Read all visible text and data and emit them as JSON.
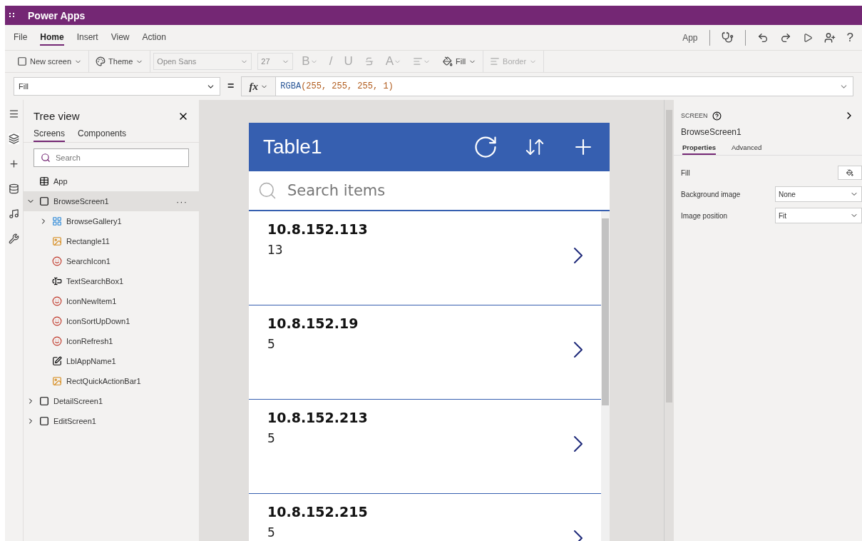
{
  "app_bar": {
    "title": "Power Apps"
  },
  "menu": [
    {
      "label": "File",
      "selected": false
    },
    {
      "label": "Home",
      "selected": true
    },
    {
      "label": "Insert",
      "selected": false
    },
    {
      "label": "View",
      "selected": false
    },
    {
      "label": "Action",
      "selected": false
    }
  ],
  "app_label": "App",
  "help_label": "?",
  "toolbar": [
    {
      "kind": "newscreen",
      "label": "New screen",
      "disabled": false
    },
    {
      "kind": "theme",
      "label": "Theme",
      "disabled": false
    },
    {
      "kind": "font",
      "label": "Open Sans",
      "disabled": true
    },
    {
      "kind": "size",
      "label": "27",
      "disabled": true
    },
    {
      "kind": "bold",
      "label": "B",
      "disabled": true
    },
    {
      "kind": "italic",
      "label": "/",
      "disabled": true
    },
    {
      "kind": "underline",
      "label": "U",
      "disabled": true
    },
    {
      "kind": "strike",
      "disabled": true
    },
    {
      "kind": "color",
      "label": "A",
      "disabled": true
    },
    {
      "kind": "align",
      "disabled": true
    },
    {
      "kind": "fill",
      "label": "Fill",
      "disabled": false
    },
    {
      "kind": "border",
      "label": "Border",
      "disabled": true
    }
  ],
  "formula": {
    "property": "Fill",
    "equals": "=",
    "fx": "fx",
    "func": "RGBA",
    "args": "(255, 255, 255, 1)"
  },
  "tree": {
    "title": "Tree view",
    "tabs": [
      {
        "label": "Screens",
        "selected": true
      },
      {
        "label": "Components",
        "selected": false
      }
    ],
    "search": {
      "placeholder": "Search"
    },
    "items": [
      {
        "kind": "app",
        "label": "App",
        "selected": false
      },
      {
        "kind": "screen",
        "label": "BrowseScreen1",
        "expanded": true,
        "selected": true,
        "more": "···",
        "children": [
          {
            "kind": "gallery",
            "label": "BrowseGallery1",
            "expanded": false
          },
          {
            "kind": "rectangle",
            "label": "Rectangle11"
          },
          {
            "kind": "icon",
            "label": "SearchIcon1"
          },
          {
            "kind": "textbox",
            "label": "TextSearchBox1"
          },
          {
            "kind": "icon",
            "label": "IconNewItem1"
          },
          {
            "kind": "icon",
            "label": "IconSortUpDown1"
          },
          {
            "kind": "icon",
            "label": "IconRefresh1"
          },
          {
            "kind": "label",
            "label": "LblAppName1"
          },
          {
            "kind": "rectangle",
            "label": "RectQuickActionBar1"
          }
        ]
      },
      {
        "kind": "screen",
        "label": "DetailScreen1",
        "expanded": false,
        "selected": false
      },
      {
        "kind": "screen",
        "label": "EditScreen1",
        "expanded": false,
        "selected": false
      }
    ]
  },
  "phone": {
    "title": "Table1",
    "search": {
      "placeholder": "Search items"
    },
    "items": [
      {
        "title": "10.8.152.113",
        "subtitle": "13"
      },
      {
        "title": "10.8.152.19",
        "subtitle": "5"
      },
      {
        "title": "10.8.152.213",
        "subtitle": "5"
      },
      {
        "title": "10.8.152.215",
        "subtitle": "5"
      }
    ]
  },
  "properties": {
    "section": "SCREEN",
    "name": "BrowseScreen1",
    "tabs": [
      {
        "label": "Properties",
        "selected": true
      },
      {
        "label": "Advanced",
        "selected": false
      }
    ],
    "rows": [
      {
        "kind": "color",
        "label": "Fill"
      },
      {
        "kind": "select",
        "label": "Background image",
        "value": "None"
      },
      {
        "kind": "select",
        "label": "Image position",
        "value": "Fit"
      }
    ]
  }
}
